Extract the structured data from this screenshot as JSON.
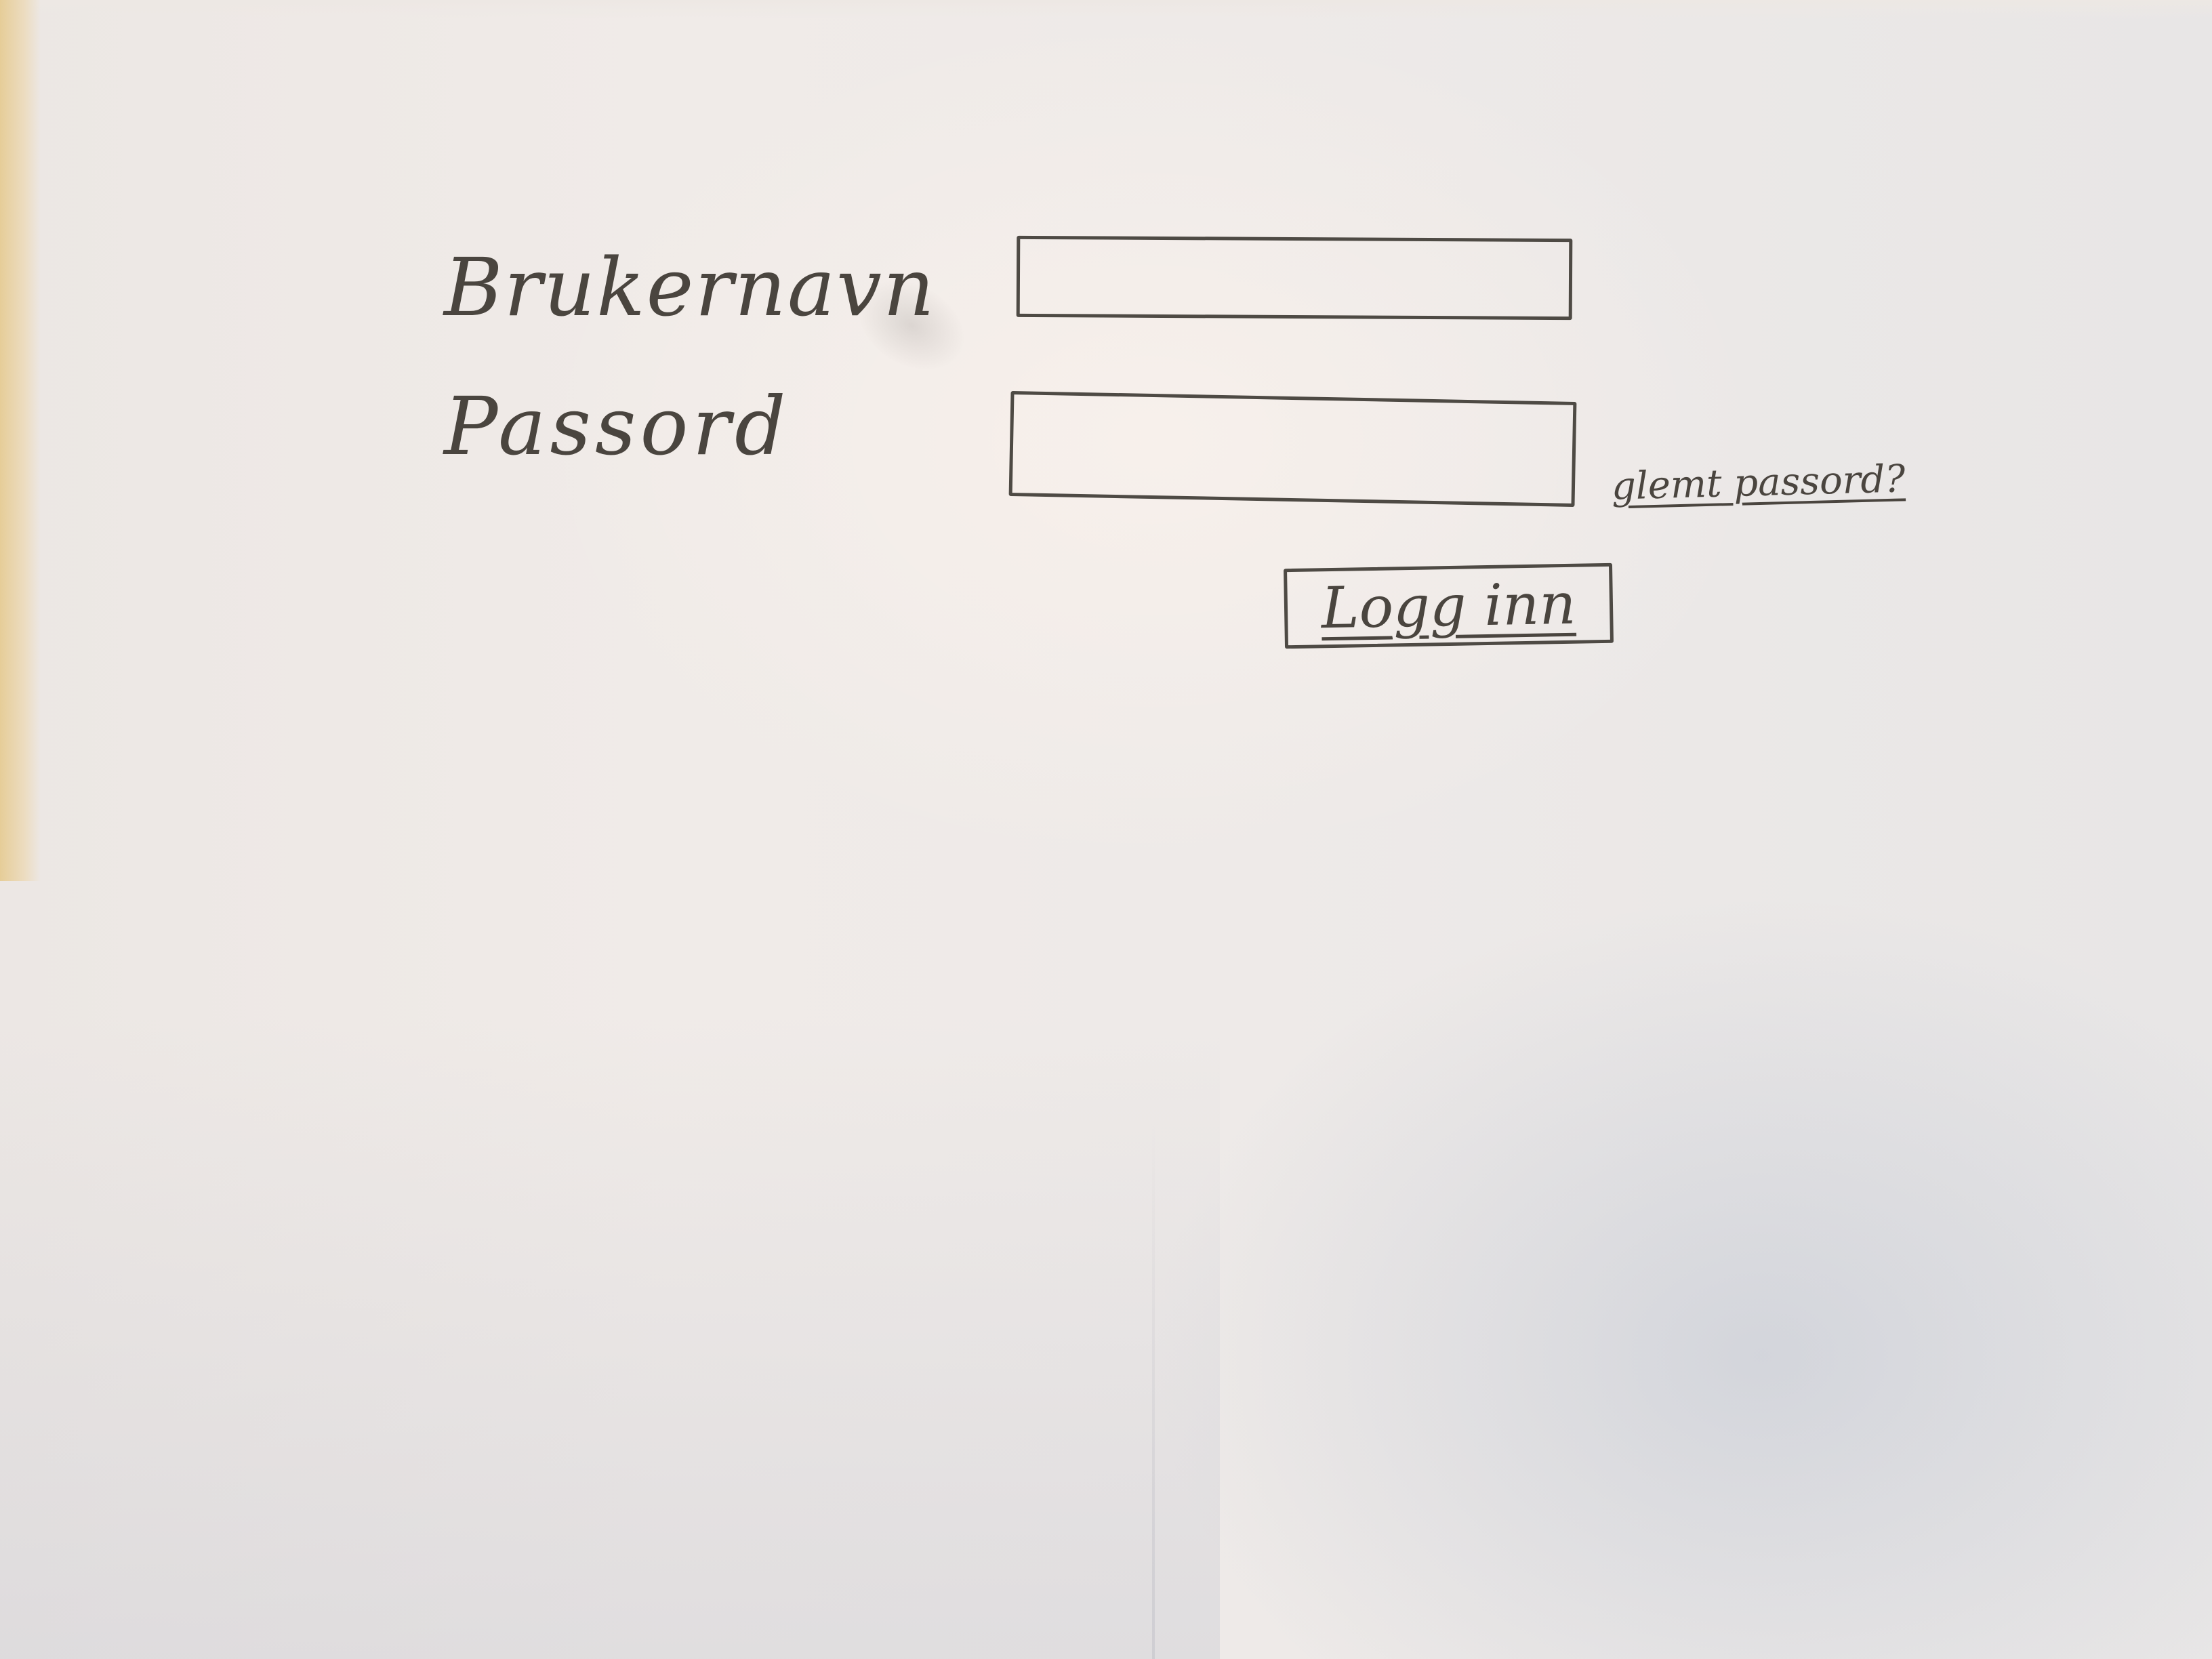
{
  "form": {
    "username_label": "Brukernavn",
    "password_label": "Passord",
    "username_value": "",
    "password_value": "",
    "forgot_password_link": "glemt passord?",
    "login_button_label": "Logg inn"
  },
  "colors": {
    "ink": "#4a453f",
    "paper": "#eeeae8"
  }
}
